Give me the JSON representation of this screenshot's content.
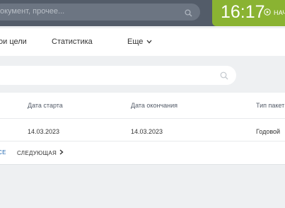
{
  "header": {
    "search_placeholder": "окумент, прочее...",
    "clock": "16:17",
    "start_label": "НАЧ"
  },
  "nav": {
    "items": [
      "ои цели",
      "Статистика"
    ],
    "more_label": "Еще"
  },
  "table": {
    "columns": [
      "Дата старта",
      "Дата окончания",
      "Тип пакет"
    ],
    "rows": [
      {
        "start": "14.03.2023",
        "end": "14.03.2023",
        "type": "Годовой"
      }
    ]
  },
  "pagination": {
    "prev_label": "СЕ",
    "next_label": "СЛЕДУЮЩАЯ"
  },
  "colors": {
    "topbar": "#535c69",
    "clock_bg": "#8ab332",
    "link": "#2067b0"
  }
}
